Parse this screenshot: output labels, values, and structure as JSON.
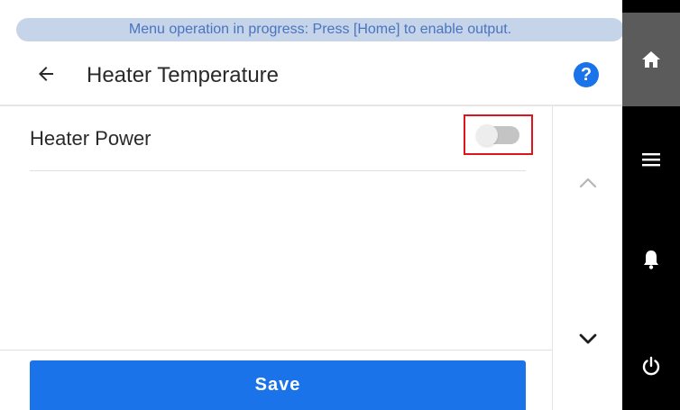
{
  "status": {
    "banner_text": "Menu operation in progress: Press [Home] to enable output."
  },
  "header": {
    "title": "Heater Temperature",
    "back_icon": "arrow-left-icon",
    "help_label": "?",
    "help_icon": "help-circle-icon"
  },
  "settings": {
    "items": [
      {
        "label": "Heater Power",
        "control": "toggle",
        "state": "off"
      }
    ]
  },
  "scroll": {
    "up_icon": "chevron-up-icon",
    "down_icon": "chevron-down-icon"
  },
  "footer": {
    "save_label": "Save"
  },
  "nav": {
    "items": [
      {
        "name": "home",
        "icon": "home-icon",
        "active": true
      },
      {
        "name": "menu",
        "icon": "menu-icon"
      },
      {
        "name": "notifications",
        "icon": "bell-icon"
      },
      {
        "name": "power",
        "icon": "power-icon"
      }
    ]
  },
  "colors": {
    "accent": "#1a73e8",
    "banner_bg": "#c5d4e8",
    "banner_text": "#4a74c2",
    "highlight": "#e0141c",
    "nav_bg": "#000000",
    "nav_active": "#5b5b5b"
  }
}
